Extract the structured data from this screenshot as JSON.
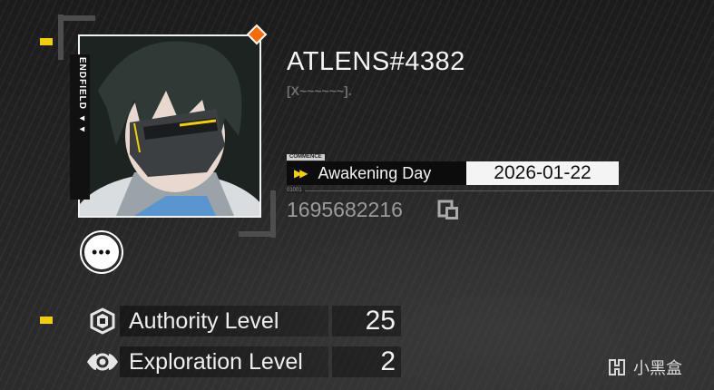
{
  "profile": {
    "username": "ATLENS#4382",
    "tagline": "[X~~~~~~].",
    "brand_label": "ENDFIELD ◂◂",
    "commence_label": "COMMENCE",
    "awakening_label": "Awakening Day",
    "awakening_date": "2026-01-22",
    "uid_caption": "01001",
    "uid": "1695682216"
  },
  "levels": [
    {
      "label": "Authority Level",
      "value": "25",
      "icon": "authority-icon"
    },
    {
      "label": "Exploration Level",
      "value": "2",
      "icon": "exploration-icon"
    }
  ],
  "more_button_label": "•••",
  "watermark": {
    "text": "小黑盒",
    "icon": "heybox-logo-icon"
  },
  "colors": {
    "accent_yellow": "#f2d000",
    "accent_orange": "#ff6a00",
    "background": "#232323"
  }
}
